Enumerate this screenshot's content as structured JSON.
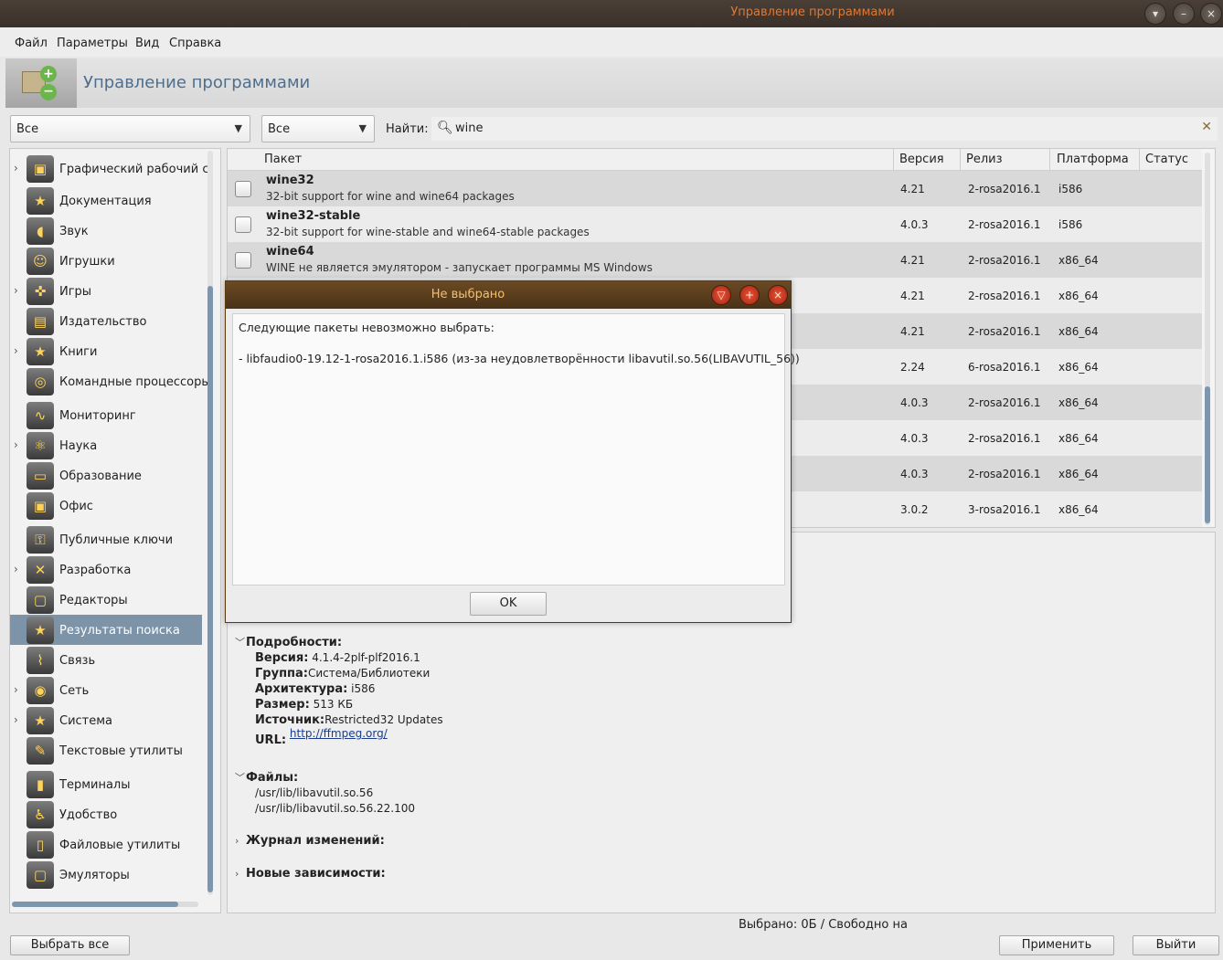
{
  "window": {
    "title": "Управление программами",
    "buttons": [
      "▾",
      "–",
      "×"
    ]
  },
  "menu": [
    "Файл",
    "Параметры",
    "Вид",
    "Справка"
  ],
  "header": {
    "title": "Управление программами"
  },
  "filters": {
    "category_combo": "Все",
    "status_combo": "Все",
    "search_label": "Найти:",
    "search_value": "wine"
  },
  "tree": {
    "items": [
      {
        "label": "Графический рабочий с",
        "expandable": true,
        "icon": "desktop-icon"
      },
      {
        "label": "Документация",
        "expandable": false,
        "icon": "star-icon"
      },
      {
        "label": "Звук",
        "expandable": false,
        "icon": "speaker-icon"
      },
      {
        "label": "Игрушки",
        "expandable": false,
        "icon": "smiley-icon"
      },
      {
        "label": "Игры",
        "expandable": true,
        "icon": "gamepad-icon"
      },
      {
        "label": "Издательство",
        "expandable": false,
        "icon": "publishing-icon"
      },
      {
        "label": "Книги",
        "expandable": true,
        "icon": "book-icon"
      },
      {
        "label": "Командные процессоры",
        "expandable": false,
        "icon": "shell-icon"
      },
      {
        "label": "Мониторинг",
        "expandable": false,
        "icon": "monitor-icon"
      },
      {
        "label": "Наука",
        "expandable": true,
        "icon": "science-icon"
      },
      {
        "label": "Образование",
        "expandable": false,
        "icon": "chalkboard-icon"
      },
      {
        "label": "Офис",
        "expandable": false,
        "icon": "office-icon"
      },
      {
        "label": "Публичные ключи",
        "expandable": false,
        "icon": "keys-icon"
      },
      {
        "label": "Разработка",
        "expandable": true,
        "icon": "tools-icon"
      },
      {
        "label": "Редакторы",
        "expandable": false,
        "icon": "editor-icon"
      },
      {
        "label": "Результаты поиска",
        "expandable": false,
        "icon": "star-icon",
        "selected": true
      },
      {
        "label": "Связь",
        "expandable": false,
        "icon": "antenna-icon"
      },
      {
        "label": "Сеть",
        "expandable": true,
        "icon": "network-icon"
      },
      {
        "label": "Система",
        "expandable": true,
        "icon": "system-icon"
      },
      {
        "label": "Текстовые утилиты",
        "expandable": false,
        "icon": "pen-icon"
      },
      {
        "label": "Терминалы",
        "expandable": false,
        "icon": "terminal-icon"
      },
      {
        "label": "Удобство",
        "expandable": false,
        "icon": "accessibility-icon"
      },
      {
        "label": "Файловые утилиты",
        "expandable": false,
        "icon": "file-tools-icon"
      },
      {
        "label": "Эмуляторы",
        "expandable": false,
        "icon": "emulator-icon"
      }
    ]
  },
  "table": {
    "columns": [
      "Пакет",
      "Версия",
      "Релиз",
      "Платформа",
      "Статус"
    ],
    "rows": [
      {
        "name": "wine32",
        "desc": "32-bit support for wine and wine64 packages",
        "version": "4.21",
        "release": "2-rosa2016.1",
        "platform": "i586"
      },
      {
        "name": "wine32-stable",
        "desc": "32-bit support for wine-stable and wine64-stable packages",
        "version": "4.0.3",
        "release": "2-rosa2016.1",
        "platform": "i586"
      },
      {
        "name": "wine64",
        "desc": "WINE не является эмулятором - запускает программы MS Windows",
        "version": "4.21",
        "release": "2-rosa2016.1",
        "platform": "x86_64"
      },
      {
        "name": "",
        "desc": "",
        "version": "4.21",
        "release": "2-rosa2016.1",
        "platform": "x86_64"
      },
      {
        "name": "",
        "desc": "",
        "version": "4.21",
        "release": "2-rosa2016.1",
        "platform": "x86_64"
      },
      {
        "name": "",
        "desc": "",
        "version": "2.24",
        "release": "6-rosa2016.1",
        "platform": "x86_64"
      },
      {
        "name": "",
        "desc": "",
        "version": "4.0.3",
        "release": "2-rosa2016.1",
        "platform": "x86_64"
      },
      {
        "name": "",
        "desc": "",
        "version": "4.0.3",
        "release": "2-rosa2016.1",
        "platform": "x86_64"
      },
      {
        "name": "",
        "desc": "",
        "version": "4.0.3",
        "release": "2-rosa2016.1",
        "platform": "x86_64"
      },
      {
        "name": "",
        "desc": "",
        "version": "3.0.2",
        "release": "3-rosa2016.1",
        "platform": "x86_64"
      }
    ]
  },
  "details": {
    "section_title": "Подробности:",
    "version_label": "Версия:",
    "version_value": "4.1.4-2plf-plf2016.1",
    "group_label": "Группа:",
    "group_value": "Система/Библиотеки",
    "arch_label": "Архитектура:",
    "arch_value": "i586",
    "size_label": "Размер:",
    "size_value": "513 КБ",
    "source_label": "Источник:",
    "source_value": "Restricted32 Updates",
    "url_label": "URL:",
    "url_value": "http://ffmpeg.org/",
    "files_title": "Файлы:",
    "files": [
      "/usr/lib/libavutil.so.56",
      "/usr/lib/libavutil.so.56.22.100"
    ],
    "changelog_title": "Журнал изменений:",
    "deps_title": "Новые зависимости:"
  },
  "status": {
    "text": "Выбрано: 0Б / Свободно на"
  },
  "buttons": {
    "select_all": "Выбрать все",
    "apply": "Применить",
    "quit": "Выйти"
  },
  "dialog": {
    "title": "Не выбрано",
    "buttons": [
      "▽",
      "+",
      "×"
    ],
    "line1": "Следующие пакеты невозможно выбрать:",
    "line2": "- libfaudio0-19.12-1-rosa2016.1.i586 (из-за неудовлетворённости libavutil.so.56(LIBAVUTIL_56))",
    "ok": "OK"
  },
  "colors": {
    "selection": "#7c93a8",
    "title_text": "#d87a3c",
    "dialog_title_text": "#f3c06a",
    "header_title": "#4f6e8c"
  }
}
